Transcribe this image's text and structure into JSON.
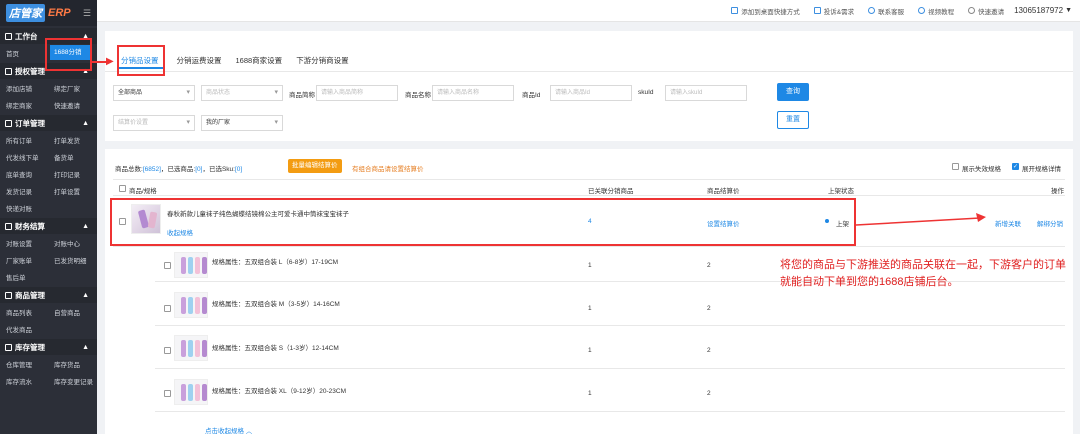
{
  "brand": {
    "logo_text": "店管家",
    "logo_suffix": "ERP"
  },
  "sidebar": [
    {
      "title": "工作台",
      "items": [
        "首页",
        "1688分销"
      ],
      "active": "1688分销"
    },
    {
      "title": "授权管理",
      "items": [
        "添加店铺",
        "绑定厂家",
        "绑定商家",
        "快速邀请"
      ]
    },
    {
      "title": "订单管理",
      "items": [
        "所有订单",
        "打单发货",
        "代发线下单",
        "备货单",
        "底单查询",
        "打印记录",
        "发货记录",
        "打单设置",
        "快递对账"
      ]
    },
    {
      "title": "财务结算",
      "items": [
        "对账设置",
        "对账中心",
        "厂家账单",
        "已发货明细",
        "售后单"
      ]
    },
    {
      "title": "商品管理",
      "items": [
        "商品列表",
        "自营商品",
        "代发商品"
      ]
    },
    {
      "title": "库存管理",
      "items": [
        "仓库管理",
        "库存货品",
        "库存流水",
        "库存变更记录"
      ]
    }
  ],
  "topbar": {
    "shortcut": "添加到桌面快捷方式",
    "complaint": "投诉&需求",
    "service": "联系客服",
    "video": "视频教程",
    "invite": "快速邀请",
    "user": "13065187972"
  },
  "tabs": [
    "分销品设置",
    "分销运费设置",
    "1688商家设置",
    "下游分销商设置"
  ],
  "filters": {
    "all_goods": "全部商品",
    "goods_status": "商品状态",
    "title_label": "商品简称",
    "title_ph": "请输入商品简称",
    "name_label": "商品名称",
    "name_ph": "请输入商品名称",
    "id_label": "商品Id",
    "id_ph": "请输入商品Id",
    "skuid_label": "skuId",
    "skuid_ph": "请输入skuId",
    "settle_setting": "结算价设置",
    "my_factory": "我的厂家",
    "search_btn": "查询",
    "reset_btn": "重置"
  },
  "summary": {
    "total_label": "商品总数:",
    "total": "[6852]",
    "sel_label": "已选商品:",
    "sel": "[0]",
    "sku_label": "已选Sku:",
    "sku": "[0]",
    "batch_btn": "批量编辑结算价",
    "warning": "有组合商品请设置结算价",
    "show_invalid": "展示失效规格",
    "expand_specs": "展开规格详情"
  },
  "table": {
    "headers": {
      "goods": "商品/规格",
      "linked": "已关联分销商品",
      "price": "商品结算价",
      "status": "上架状态",
      "ops": "操作"
    },
    "product": {
      "title": "春秋新款儿童袜子纯色蝴蝶结镜棉公主可爱卡通中筒袜宝宝袜子",
      "collapse": "收起规格",
      "linked": "4",
      "price_link": "设置结算价",
      "status": "上架",
      "op1": "新增关联",
      "op2": "解绑分销"
    },
    "skus": [
      {
        "spec": "规格属性：五双组合装 L（6-8岁）17-19CM",
        "linked": "1",
        "price": "2"
      },
      {
        "spec": "规格属性：五双组合装 M（3-5岁）14-16CM",
        "linked": "1",
        "price": "2"
      },
      {
        "spec": "规格属性：五双组合装 S（1-3岁）12-14CM",
        "linked": "1",
        "price": "2"
      },
      {
        "spec": "规格属性：五双组合装 XL（9-12岁）20-23CM",
        "linked": "1",
        "price": "2"
      }
    ],
    "footer_collapse": "点击收起规格 ︿"
  },
  "annotation": "将您的商品与下游推送的商品关联在一起，下游客户的订单就能自动下单到您的1688店铺后台。",
  "colors": {
    "accent": "#1e88e5",
    "sidebar": "#2c2f38",
    "annotation": "#e02020",
    "batch": "#f39c12"
  }
}
